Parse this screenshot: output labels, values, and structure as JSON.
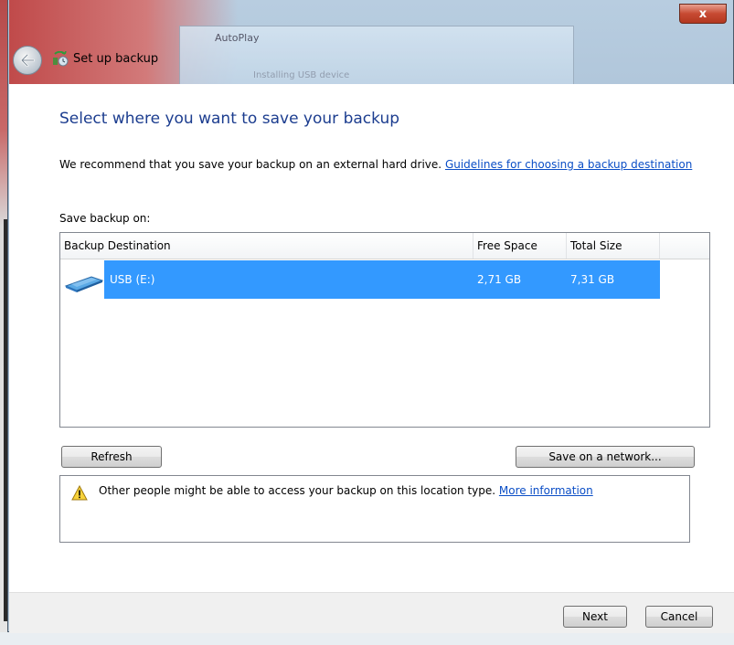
{
  "window": {
    "title": "Set up backup",
    "close_glyph": "x",
    "background_window_title": "AutoPlay",
    "background_window_subtitle": "Installing USB device"
  },
  "page": {
    "heading": "Select where you want to save your backup",
    "intro_text": "We recommend that you save your backup on an external hard drive.",
    "intro_link": "Guidelines for choosing a backup destination",
    "save_on_label": "Save backup on:"
  },
  "destination_list": {
    "columns": [
      "Backup Destination",
      "Free Space",
      "Total Size"
    ],
    "rows": [
      {
        "name": "USB (E:)",
        "free_space": "2,71 GB",
        "total_size": "7,31 GB",
        "selected": true,
        "icon": "usb-drive-icon"
      }
    ]
  },
  "buttons": {
    "refresh": "Refresh",
    "save_on_network": "Save on a network...",
    "next": "Next",
    "cancel": "Cancel"
  },
  "warning": {
    "text": "Other people might be able to access your backup on this location type.",
    "link": "More information",
    "icon": "warning-icon"
  },
  "colors": {
    "heading": "#1c3d8f",
    "link": "#0b4ec6",
    "selection": "#3399ff",
    "close_button": "#c74a32"
  }
}
